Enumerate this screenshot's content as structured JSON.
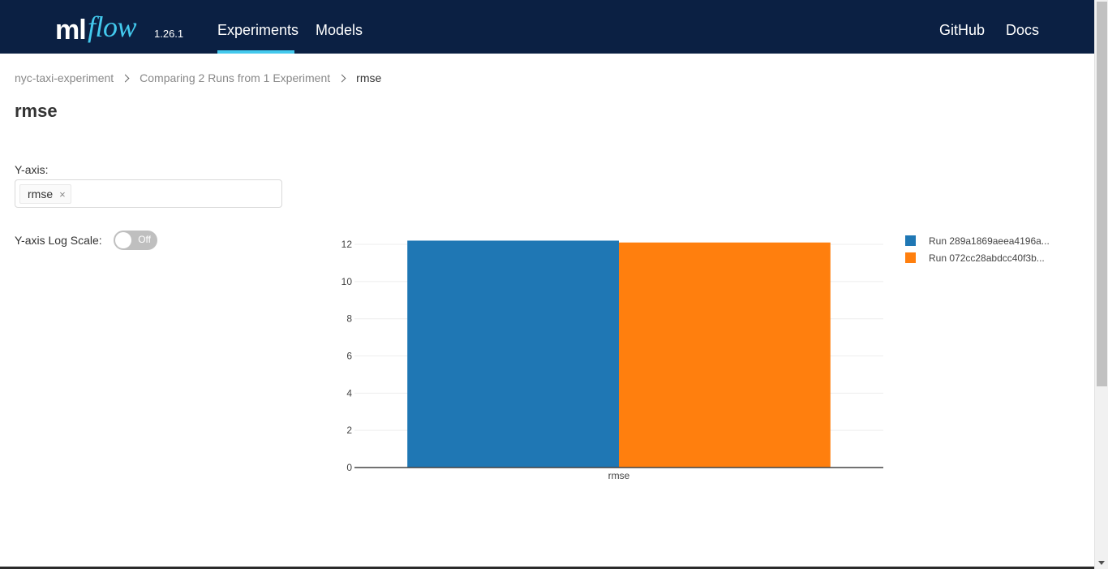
{
  "header": {
    "logo": {
      "ml": "ml",
      "flow": "flow",
      "version": "1.26.1"
    },
    "nav": {
      "experiments": "Experiments",
      "models": "Models",
      "github": "GitHub",
      "docs": "Docs"
    }
  },
  "breadcrumb": {
    "items": [
      "nyc-taxi-experiment",
      "Comparing 2 Runs from 1 Experiment",
      "rmse"
    ]
  },
  "page_title": "rmse",
  "controls": {
    "yaxis_label": "Y-axis:",
    "yaxis_selected": "rmse",
    "yaxis_remove_glyph": "×",
    "log_scale_label": "Y-axis Log Scale:",
    "log_scale_state": "Off"
  },
  "colors": {
    "header_bg": "#0b2043",
    "accent": "#43c9ed",
    "series_1": "#1f77b4",
    "series_2": "#ff7f0e"
  },
  "chart_data": {
    "type": "bar",
    "categories": [
      "rmse"
    ],
    "series": [
      {
        "name": "Run 289a1869aeea4196a...",
        "values": [
          12.2
        ],
        "color": "#1f77b4"
      },
      {
        "name": "Run 072cc28abdcc40f3b...",
        "values": [
          12.1
        ],
        "color": "#ff7f0e"
      }
    ],
    "yticks": [
      0,
      2,
      4,
      6,
      8,
      10,
      12
    ],
    "ylim": [
      0,
      12.7
    ],
    "grid": true,
    "legend_position": "right"
  }
}
